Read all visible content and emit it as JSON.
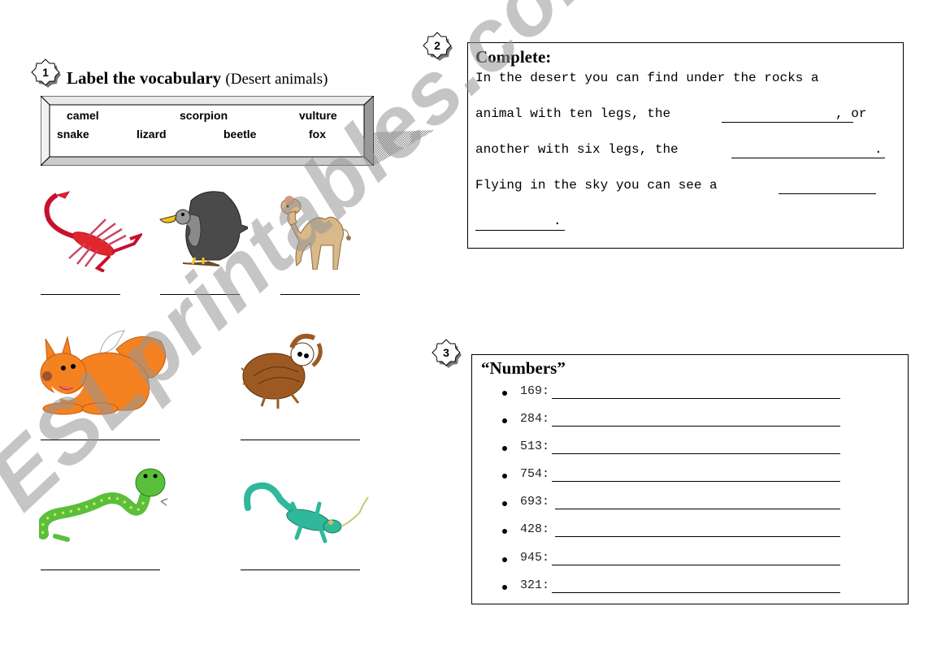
{
  "section1": {
    "badge": "1",
    "title": "Label the vocabulary",
    "subtitle": "(Desert animals)",
    "vocabulary": [
      "camel",
      "scorpion",
      "vulture",
      "snake",
      "lizard",
      "beetle",
      "fox"
    ],
    "pictures": [
      {
        "animal": "scorpion-picture"
      },
      {
        "animal": "vulture-picture"
      },
      {
        "animal": "camel-picture"
      },
      {
        "animal": "fox-picture"
      },
      {
        "animal": "beetle-picture"
      },
      {
        "animal": "snake-picture"
      },
      {
        "animal": "lizard-picture"
      }
    ]
  },
  "section2": {
    "badge": "2",
    "heading": "Complete:",
    "lines": [
      "In the desert you can find under the rocks a",
      "animal with ten legs, the",
      ", or",
      "another with six legs, the",
      ".",
      "Flying in the sky you can see a",
      "."
    ]
  },
  "section3": {
    "badge": "3",
    "heading": "“Numbers”",
    "items": [
      "169:",
      "284:",
      "513:",
      "754:",
      "693:",
      "428:",
      "945:",
      "321:"
    ]
  },
  "watermark": "ESLprintables.com"
}
